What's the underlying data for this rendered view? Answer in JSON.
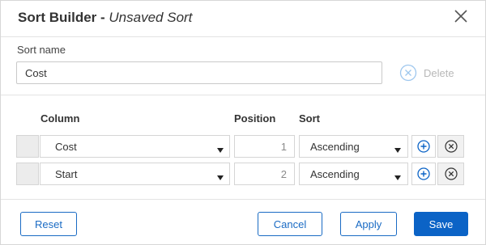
{
  "dialog": {
    "title_main": "Sort Builder - ",
    "title_sub": "Unsaved Sort"
  },
  "sort_name": {
    "label": "Sort name",
    "value": "Cost"
  },
  "delete": {
    "label": "Delete"
  },
  "table": {
    "headers": {
      "column": "Column",
      "position": "Position",
      "sort": "Sort"
    },
    "rows": [
      {
        "column": "Cost",
        "position": "1",
        "sort": "Ascending"
      },
      {
        "column": "Start",
        "position": "2",
        "sort": "Ascending"
      }
    ]
  },
  "footer": {
    "reset": "Reset",
    "cancel": "Cancel",
    "apply": "Apply",
    "save": "Save"
  },
  "colors": {
    "accent": "#0b63c6",
    "icon_disabled": "#9ec7ee"
  }
}
